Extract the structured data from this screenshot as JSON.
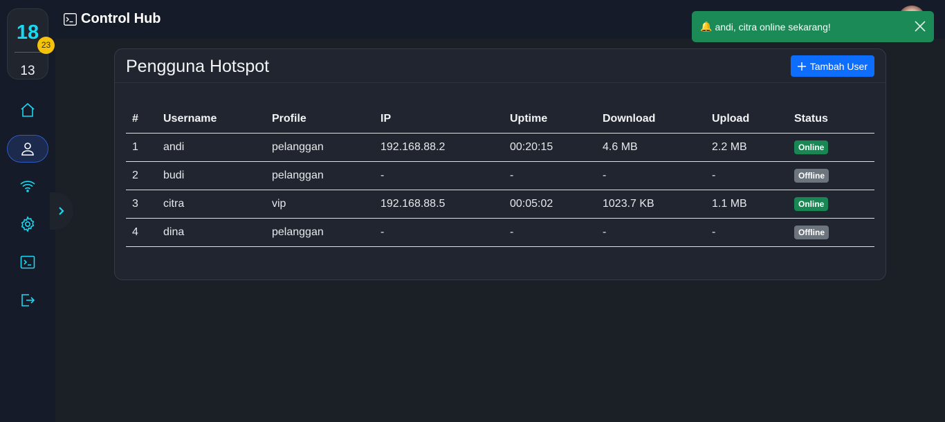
{
  "app": {
    "title": "Control Hub"
  },
  "clock": {
    "hour": "18",
    "minute": "13",
    "second": "23"
  },
  "sidebar": {
    "items": [
      {
        "icon": "home-icon"
      },
      {
        "icon": "user-icon",
        "active": true
      },
      {
        "icon": "wifi-icon"
      },
      {
        "icon": "gear-icon"
      },
      {
        "icon": "terminal-icon"
      },
      {
        "icon": "logout-icon"
      }
    ]
  },
  "toast": {
    "message": "andi, citra online sekarang!",
    "emoji": "🔔"
  },
  "card": {
    "title": "Pengguna Hotspot",
    "add_button": "Tambah User"
  },
  "table": {
    "headers": [
      "#",
      "Username",
      "Profile",
      "IP",
      "Uptime",
      "Download",
      "Upload",
      "Status"
    ],
    "rows": [
      {
        "no": "1",
        "username": "andi",
        "profile": "pelanggan",
        "ip": "192.168.88.2",
        "uptime": "00:20:15",
        "download": "4.6 MB",
        "upload": "2.2 MB",
        "status": "Online"
      },
      {
        "no": "2",
        "username": "budi",
        "profile": "pelanggan",
        "ip": "-",
        "uptime": "-",
        "download": "-",
        "upload": "-",
        "status": "Offline"
      },
      {
        "no": "3",
        "username": "citra",
        "profile": "vip",
        "ip": "192.168.88.5",
        "uptime": "00:05:02",
        "download": "1023.7 KB",
        "upload": "1.1 MB",
        "status": "Online"
      },
      {
        "no": "4",
        "username": "dina",
        "profile": "pelanggan",
        "ip": "-",
        "uptime": "-",
        "download": "-",
        "upload": "-",
        "status": "Offline"
      }
    ]
  },
  "colors": {
    "accent": "#19d9f0",
    "primary": "#0d6efd",
    "success": "#198754",
    "secondary": "#6c757d"
  }
}
